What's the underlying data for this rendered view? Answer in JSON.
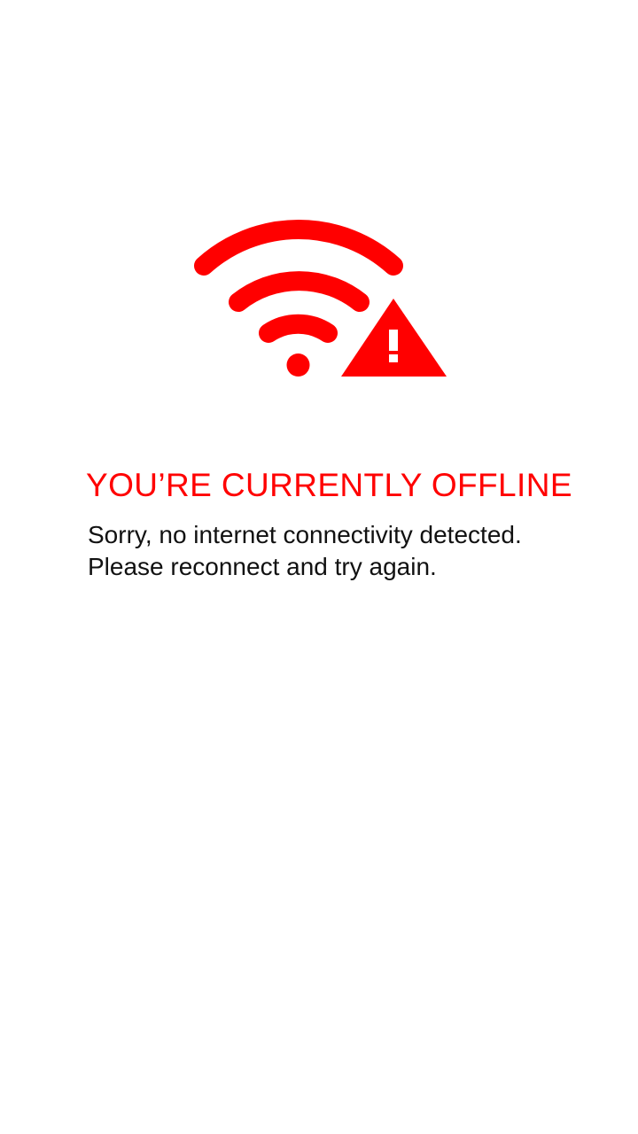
{
  "offline": {
    "icon": "wifi-warning-icon",
    "title": "YOU’RE CURRENTLY OFFLINE",
    "message_line1": "Sorry, no internet connectivity detected.",
    "message_line2": "Please reconnect and try again."
  },
  "colors": {
    "accent": "#ff0000",
    "text": "#111111",
    "background": "#ffffff"
  }
}
